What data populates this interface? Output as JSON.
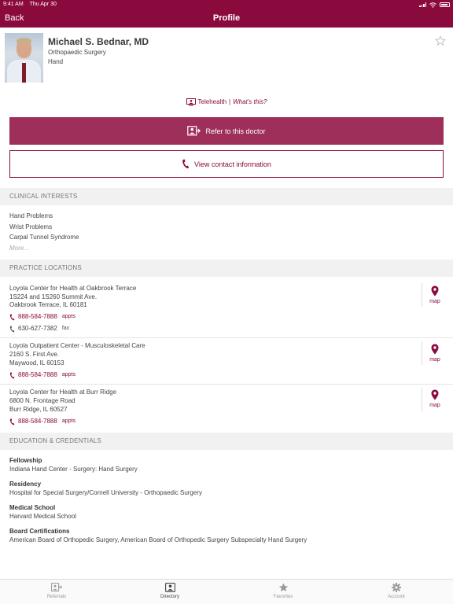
{
  "status": {
    "time": "9:41 AM",
    "date": "Thu Apr 30"
  },
  "nav": {
    "back": "Back",
    "title": "Profile"
  },
  "profile": {
    "name": "Michael S. Bednar, MD",
    "specialty": "Orthopaedic Surgery",
    "subspecialty": "Hand",
    "favorite_icon": "star-outline-icon"
  },
  "telehealth": {
    "label": "Telehealth",
    "separator": "|",
    "help": "What's this?"
  },
  "actions": {
    "refer": "Refer to this doctor",
    "contact": "View contact information"
  },
  "clinical": {
    "heading": "CLINICAL INTERESTS",
    "items": [
      "Hand Problems",
      "Wrist Problems",
      "Carpal Tunnel Syndrome"
    ],
    "more": "More..."
  },
  "practice": {
    "heading": "PRACTICE LOCATIONS",
    "map_label": "map",
    "locations": [
      {
        "name": "Loyola Center for Health at Oakbrook Terrace",
        "line1": "1S224 and 1S260 Summit Ave.",
        "line2": "Oakbrook Terrace, IL 60181",
        "phone": "888-584-7888",
        "phone_tag": "appts",
        "fax": "630-627-7382",
        "fax_tag": "fax"
      },
      {
        "name": "Loyola Outpatient Center - Musculoskeletal Care",
        "line1": "2160 S. First Ave.",
        "line2": "Maywood, IL 60153",
        "phone": "888-584-7888",
        "phone_tag": "appts"
      },
      {
        "name": "Loyola Center for Health at Burr Ridge",
        "line1": "6800 N. Frontage Road",
        "line2": "Burr Ridge, IL 60527",
        "phone": "888-584-7888",
        "phone_tag": "appts"
      }
    ]
  },
  "education": {
    "heading": "EDUCATION & CREDENTIALS",
    "items": [
      {
        "title": "Fellowship",
        "value": "Indiana Hand Center - Surgery: Hand Surgery"
      },
      {
        "title": "Residency",
        "value": "Hospital for Special Surgery/Cornell University - Orthopaedic Surgery"
      },
      {
        "title": "Medical School",
        "value": "Harvard Medical School"
      },
      {
        "title": "Board Certifications",
        "value": "American Board of Orthopedic Surgery, American Board of Orthopedic Surgery Subspecialty Hand Surgery"
      }
    ]
  },
  "tabs": [
    {
      "label": "Referrals",
      "icon": "referral-icon"
    },
    {
      "label": "Directory",
      "icon": "directory-icon",
      "active": true
    },
    {
      "label": "Favorites",
      "icon": "star-icon"
    },
    {
      "label": "Account",
      "icon": "gear-icon"
    }
  ],
  "colors": {
    "brand": "#8b0a3e",
    "refer_button": "#9e2f5a",
    "section_bg": "#f1f1f1"
  }
}
